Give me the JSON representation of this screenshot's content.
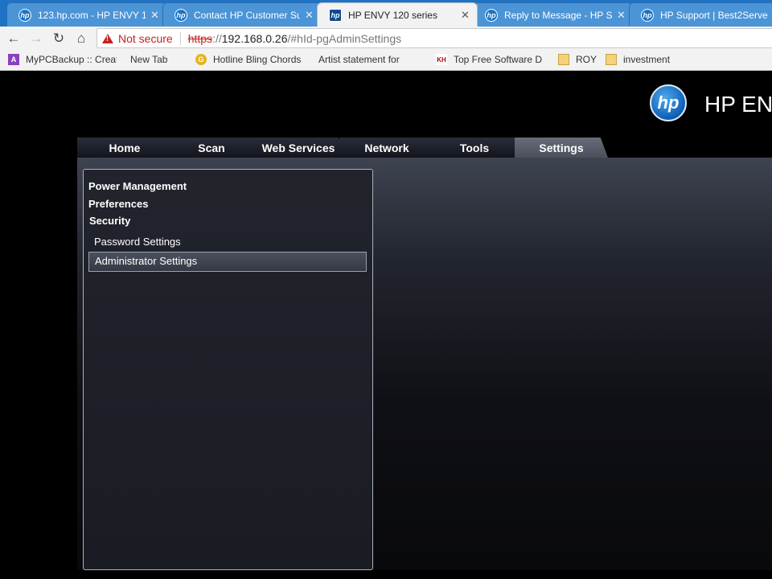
{
  "browser": {
    "tabs": [
      {
        "title": "123.hp.com - HP ENVY 1",
        "favicon": "hp-icon"
      },
      {
        "title": "Contact HP Customer Su",
        "favicon": "hp-icon"
      },
      {
        "title": "HP ENVY 120 series",
        "favicon": "hp-icon",
        "active": true
      },
      {
        "title": "Reply to Message - HP S",
        "favicon": "hp-icon"
      },
      {
        "title": "HP Support | Best2Serve",
        "favicon": "hp-icon"
      }
    ],
    "close_glyph": "✕",
    "address": {
      "security_label": "Not secure",
      "scheme": "https",
      "scheme_sep": "://",
      "host": "192.168.0.26",
      "path": "/#hId-pgAdminSettings"
    },
    "bookmarks": [
      {
        "label": "MyPCBackup :: Creat",
        "icon": "mypcbackup-icon"
      },
      {
        "label": "New Tab",
        "icon": "page-icon"
      },
      {
        "label": "Hotline Bling Chords",
        "icon": "chords-icon"
      },
      {
        "label": "Artist statement for",
        "icon": "page-icon"
      },
      {
        "label": "Top Free Software D",
        "icon": "kh-icon"
      },
      {
        "label": "ROY",
        "icon": "folder-icon"
      },
      {
        "label": "investment",
        "icon": "folder-icon"
      }
    ]
  },
  "page": {
    "product_title": "HP EN",
    "logo_text": "hp",
    "nav_tabs": [
      {
        "label": "Home"
      },
      {
        "label": "Scan"
      },
      {
        "label": "Web Services"
      },
      {
        "label": "Network"
      },
      {
        "label": "Tools"
      },
      {
        "label": "Settings",
        "selected": true
      }
    ],
    "side_menu": {
      "power_management": "Power Management",
      "preferences": "Preferences",
      "security": "Security",
      "password_settings": "Password Settings",
      "administrator_settings": "Administrator Settings"
    }
  },
  "colors": {
    "tabstrip": "#1f73c5",
    "not_secure": "#c5221f",
    "selected_nav": "#5a5f6b"
  }
}
